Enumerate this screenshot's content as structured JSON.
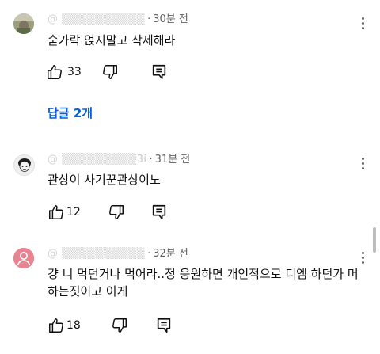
{
  "comments": [
    {
      "handle": "@",
      "timestamp": "30분 전",
      "text": "숟가락 얹지말고 삭제해라",
      "likes": "33",
      "replies_label": "답글 2개",
      "avatar_icon": "photo-avatar"
    },
    {
      "handle": "@",
      "handle_suffix": "3i",
      "timestamp": "31분 전",
      "text": "관상이 사기꾼관상이노",
      "likes": "12",
      "avatar_icon": "sketch-avatar"
    },
    {
      "handle": "@",
      "timestamp": "32분 전",
      "text": "걍 니 먹던거나 먹어라..정 응원하면 개인적으로 디엠 하던가 머하는짓이고 이게",
      "likes": "18",
      "avatar_icon": "default-person-avatar"
    }
  ],
  "colors": {
    "link_blue": "#065fd4",
    "meta_gray": "#606060",
    "avatar_pink": "#e8838f"
  },
  "icons": [
    "thumbs-up-icon",
    "thumbs-down-icon",
    "reply-icon",
    "more-vert-icon"
  ]
}
